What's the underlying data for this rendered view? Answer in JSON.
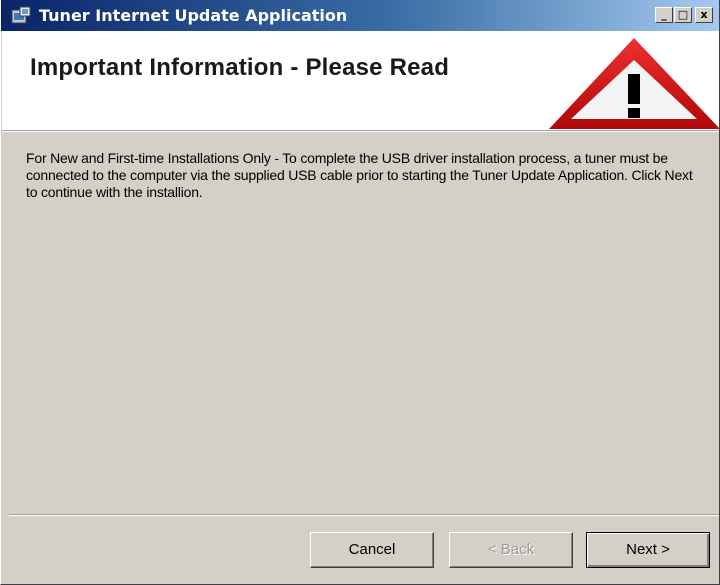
{
  "window": {
    "title": "Tuner Internet Update Application",
    "controls": {
      "minimize": "_",
      "maximize": "□",
      "close": "x"
    }
  },
  "header": {
    "heading": "Important Information - Please Read",
    "icon": "warning-triangle-icon"
  },
  "main": {
    "message": "For New and First-time Installations Only - To complete the USB driver installation process, a tuner must be connected to the computer via the supplied USB cable prior to starting the Tuner Update Application. Click Next to continue with the installion."
  },
  "footer": {
    "cancel_label": "Cancel",
    "back_label": "< Back",
    "next_label": "Next >"
  },
  "colors": {
    "titlebar_start": "#0a246a",
    "titlebar_end": "#a6caf0",
    "warning_red": "#d01010",
    "dialog_bg": "#d4d0c8"
  }
}
